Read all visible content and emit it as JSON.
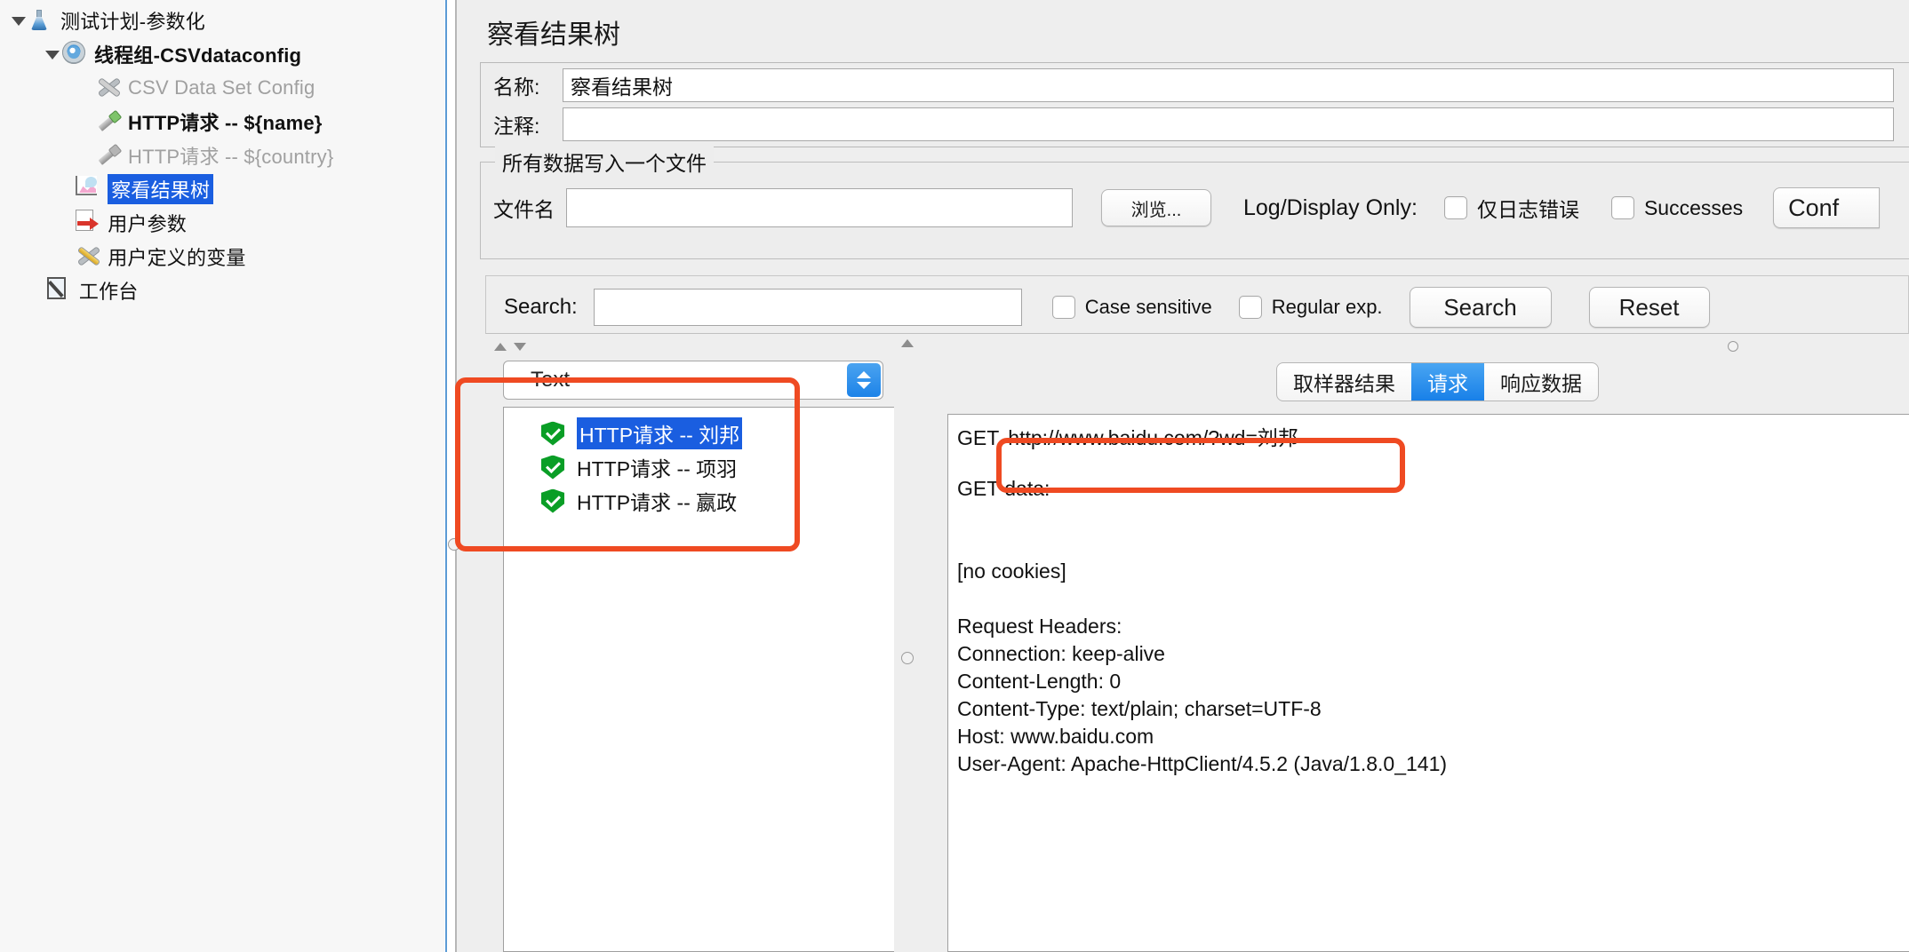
{
  "tree": {
    "items": [
      {
        "label": "测试计划-参数化",
        "icon": "flask-icon",
        "indent": 0,
        "twisty": "open",
        "state": "normal",
        "bold": false
      },
      {
        "label": "线程组-CSVdataconfig",
        "icon": "gear-icon",
        "indent": 1,
        "twisty": "open",
        "state": "normal",
        "bold": true
      },
      {
        "label": "CSV Data Set Config",
        "icon": "tools-icon",
        "indent": 2,
        "twisty": "none",
        "state": "disabled",
        "bold": false
      },
      {
        "label": "HTTP请求 -- ${name}",
        "icon": "pen-green-icon",
        "indent": 2,
        "twisty": "none",
        "state": "normal",
        "bold": true
      },
      {
        "label": "HTTP请求 -- ${country}",
        "icon": "pen-gray-icon",
        "indent": 2,
        "twisty": "none",
        "state": "disabled",
        "bold": false
      },
      {
        "label": "察看结果树",
        "icon": "chart-icon",
        "indent": 1.4,
        "twisty": "none",
        "state": "selected",
        "bold": false
      },
      {
        "label": "用户参数",
        "icon": "arrow-doc-icon",
        "indent": 1.4,
        "twisty": "none",
        "state": "normal",
        "bold": false
      },
      {
        "label": "用户定义的变量",
        "icon": "tools-yellow-icon",
        "indent": 1.4,
        "twisty": "none",
        "state": "normal",
        "bold": false
      },
      {
        "label": "工作台",
        "icon": "workbench-icon",
        "indent": 0.55,
        "twisty": "none",
        "state": "normal",
        "bold": false
      }
    ]
  },
  "panel": {
    "title": "察看结果树",
    "name_label": "名称:",
    "name_value": "察看结果树",
    "comment_label": "注释:",
    "comment_value": ""
  },
  "file_group": {
    "legend": "所有数据写入一个文件",
    "filename_label": "文件名",
    "filename_value": "",
    "browse_button": "浏览...",
    "log_display_label": "Log/Display Only:",
    "errors_only_checkbox": "仅日志错误",
    "errors_only_checked": false,
    "successes_checkbox": "Successes",
    "successes_checked": false,
    "configure_button": "Conf"
  },
  "search": {
    "label": "Search:",
    "value": "",
    "case_sensitive_label": "Case sensitive",
    "case_sensitive_checked": false,
    "regular_exp_label": "Regular exp.",
    "regular_exp_checked": false,
    "search_button": "Search",
    "reset_button": "Reset"
  },
  "renderer": {
    "selected": "Text"
  },
  "results": {
    "rows": [
      {
        "label": "HTTP请求 -- 刘邦",
        "status": "success",
        "selected": true
      },
      {
        "label": "HTTP请求 -- 项羽",
        "status": "success",
        "selected": false
      },
      {
        "label": "HTTP请求 -- 嬴政",
        "status": "success",
        "selected": false
      }
    ]
  },
  "tabs": [
    {
      "label": "取样器结果",
      "active": false
    },
    {
      "label": "请求",
      "active": true
    },
    {
      "label": "响应数据",
      "active": false
    }
  ],
  "detail": {
    "method": "GET",
    "url": "http://www.baidu.com/?wd=刘邦",
    "lines": [
      "GET data:",
      "",
      "",
      "[no cookies]",
      "",
      "Request Headers:",
      "Connection: keep-alive",
      "Content-Length: 0",
      "Content-Type: text/plain; charset=UTF-8",
      "Host: www.baidu.com",
      "User-Agent: Apache-HttpClient/4.5.2 (Java/1.8.0_141)"
    ]
  },
  "colors": {
    "selection_blue": "#1a5ee0",
    "tab_active_blue": "#1880e8",
    "annotation_orange": "#ef4a22",
    "success_green": "#0a9e26"
  }
}
